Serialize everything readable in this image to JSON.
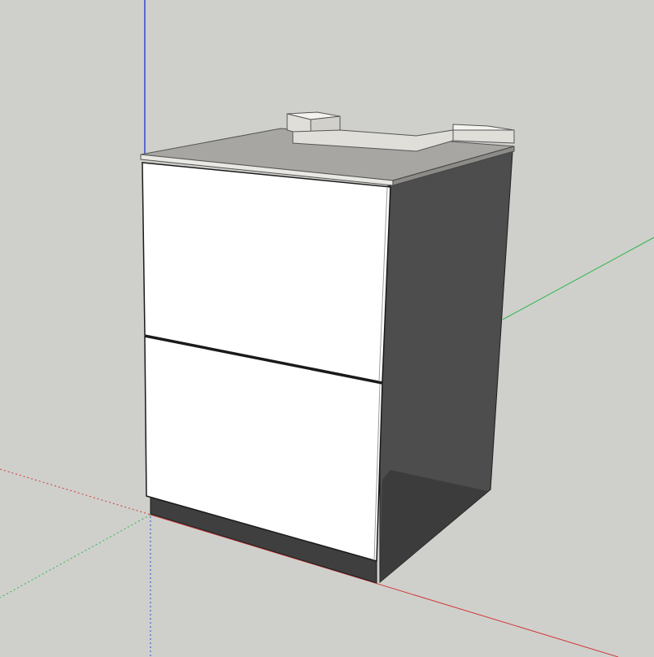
{
  "app": {
    "view": "3d-model-viewport"
  },
  "scene": {
    "background_color": "#cfd0cc",
    "axes": {
      "x_axis_color": "#d23a3a",
      "y_axis_color": "#2db64a",
      "z_axis_color": "#3146d6",
      "negative_axes_dotted": true
    },
    "model": {
      "object": "base-cabinet",
      "drawer_count": 2,
      "front_color": "#ffffff",
      "side_color": "#4d4d4d",
      "plinth_color": "#3f3f3f",
      "countertop_color": "#a7a6a2",
      "backsplash_color": "#e0ded9"
    }
  }
}
